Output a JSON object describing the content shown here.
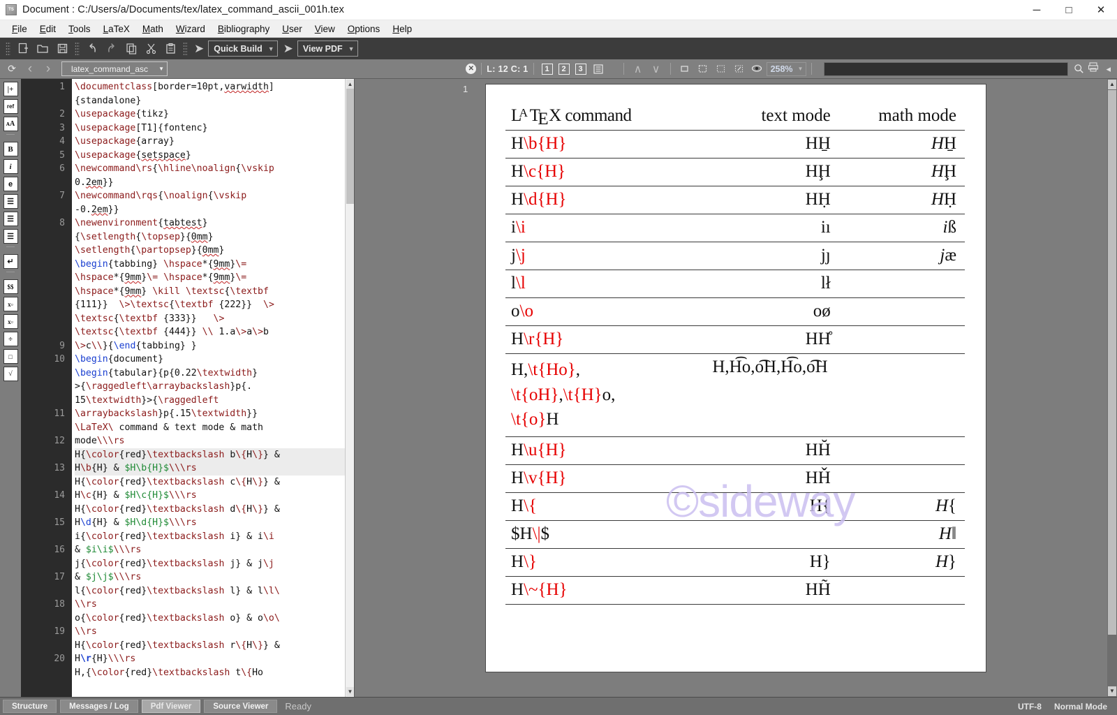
{
  "window": {
    "title": "Document : C:/Users/a/Documents/tex/latex_command_ascii_001h.tex",
    "app_icon": "texstudio-icon",
    "minimize": "─",
    "maximize": "□",
    "close": "✕"
  },
  "menu": [
    {
      "label": "File",
      "accel": "F"
    },
    {
      "label": "Edit",
      "accel": "E"
    },
    {
      "label": "Tools",
      "accel": "T"
    },
    {
      "label": "LaTeX",
      "accel": "L"
    },
    {
      "label": "Math",
      "accel": "M"
    },
    {
      "label": "Wizard",
      "accel": "W"
    },
    {
      "label": "Bibliography",
      "accel": "B"
    },
    {
      "label": "User",
      "accel": "U"
    },
    {
      "label": "View",
      "accel": "V"
    },
    {
      "label": "Options",
      "accel": "O"
    },
    {
      "label": "Help",
      "accel": "H"
    }
  ],
  "toolbar": {
    "buttons": [
      {
        "name": "new-file-icon",
        "glyph": "➕"
      },
      {
        "name": "open-file-icon",
        "glyph": "🗁"
      },
      {
        "name": "save-file-icon",
        "glyph": "💾"
      },
      {
        "name": "undo-icon",
        "glyph": "↶"
      },
      {
        "name": "redo-icon",
        "glyph": "↷"
      },
      {
        "name": "copy-icon",
        "glyph": "⧉"
      },
      {
        "name": "cut-icon",
        "glyph": "✂"
      },
      {
        "name": "paste-icon",
        "glyph": "📋"
      }
    ],
    "build_label": "Quick Build",
    "view_label": "View PDF",
    "run_glyph": "➤"
  },
  "toolbar2": {
    "refresh_icon": "⟳",
    "back_icon": "‹",
    "forward_icon": "›",
    "file_tab": "latex_command_asc",
    "close_doc_icon": "✕",
    "cursor_position": "L: 12 C: 1",
    "layout_buttons": [
      "1",
      "2",
      "3"
    ],
    "outline_icon": "☰",
    "up_icon": "∧",
    "down_icon": "∨",
    "fit_width_icon": "⬚",
    "fit_page_icon": "⛶",
    "zoom_out_icon": "⬜",
    "zoom_in_icon": "⤡",
    "magnify_icon": "👁",
    "zoom_level": "258%",
    "search_placeholder": "",
    "search_icon": "🔍",
    "print_icon": "🖨",
    "collapse_icon": "◂"
  },
  "rail_icons": [
    {
      "name": "insert-icon",
      "label": "|+"
    },
    {
      "name": "reference-icon",
      "label": "ref"
    },
    {
      "name": "font-size-icon",
      "label": "ᴀA"
    },
    {
      "name": "bold-icon",
      "label": "B"
    },
    {
      "name": "italic-icon",
      "label": "i"
    },
    {
      "name": "emphasis-icon",
      "label": "e"
    },
    {
      "name": "align-left-icon",
      "label": "☰"
    },
    {
      "name": "align-center-icon",
      "label": "☰"
    },
    {
      "name": "align-right-icon",
      "label": "☰"
    },
    {
      "name": "newline-icon",
      "label": "↵"
    },
    {
      "name": "math-inline-icon",
      "label": "$$"
    },
    {
      "name": "subscript-icon",
      "label": "x▫"
    },
    {
      "name": "superscript-icon",
      "label": "x▫"
    },
    {
      "name": "division-icon",
      "label": "÷"
    },
    {
      "name": "fraction-icon",
      "label": "□"
    },
    {
      "name": "sqrt-icon",
      "label": "√"
    }
  ],
  "editor": {
    "current_line": 12,
    "line_numbers": [
      1,
      2,
      3,
      4,
      5,
      6,
      7,
      8,
      9,
      10,
      11,
      12,
      13,
      14,
      15,
      16,
      17,
      18,
      19,
      20
    ],
    "source": [
      "\\documentclass[border=10pt,varwidth]{standalone}",
      "\\usepackage{tikz}",
      "\\usepackage[T1]{fontenc}",
      "\\usepackage{array}",
      "\\usepackage{setspace}",
      "\\newcommand\\rs{\\hline\\noalign{\\vskip 0.2em}}",
      "\\newcommand\\rqs{\\noalign{\\vskip -0.2em}}",
      "\\newenvironment{tabtest}{\\setlength{\\topsep}{0mm}\\setlength{\\partopsep}{0mm}\\begin{tabbing} \\hspace*{9mm}\\= \\hspace*{9mm}\\= \\hspace*{9mm}\\= \\hspace*{9mm} \\kill \\textsc{\\textbf{111}}  \\>\\textsc{\\textbf {222}}  \\>\\textsc{\\textbf {333}}   \\>\\textsc{\\textbf {444}} \\\\ 1.a\\>a\\>b\\>c\\\\}{\\end{tabbing} }",
      "\\begin{document}",
      "\\begin{tabular}{p{0.22\\textwidth}>{\\raggedleft\\arraybackslash}p{.15\\textwidth}>{\\raggedleft\\arraybackslash}p{.15\\textwidth}}",
      "\\LaTeX\\ command & text mode & math mode\\\\\\rs",
      "H{\\color{red}\\textbackslash b\\{H\\}} & H\\b{H} & $H\\b{H}$\\\\\\rs",
      "H{\\color{red}\\textbackslash c\\{H\\}} & H\\c{H} & $H\\c{H}$\\\\\\rs",
      "H{\\color{red}\\textbackslash d\\{H\\}} & H\\d{H} & $H\\d{H}$\\\\\\rs",
      "i{\\color{red}\\textbackslash i} & i\\i & $i\\i$\\\\\\rs",
      "j{\\color{red}\\textbackslash j} & j\\j & $j\\j$\\\\\\rs",
      "l{\\color{red}\\textbackslash l} & l\\l\\\\\\rs",
      "o{\\color{red}\\textbackslash o} & o\\o\\\\\\rs",
      "H{\\color{red}\\textbackslash r\\{H\\}} & H\\r{H}\\\\\\rs",
      "H,{\\color{red}\\textbackslash t\\{Ho"
    ]
  },
  "pdf": {
    "page_label": "1",
    "watermark": "©sideway",
    "table": {
      "headers": {
        "col1": "LaTeX command",
        "col2": "text mode",
        "col3": "math mode"
      },
      "rows": [
        {
          "cmd_plain": "H",
          "cmd_red": "\\b{H}",
          "text": "HH̲",
          "math": "HH̲",
          "math_italic_first": true
        },
        {
          "cmd_plain": "H",
          "cmd_red": "\\c{H}",
          "text": "HḨ",
          "math": "HḨ",
          "math_italic_first": true
        },
        {
          "cmd_plain": "H",
          "cmd_red": "\\d{H}",
          "text": "HḤ",
          "math": "HḤ",
          "math_italic_first": true
        },
        {
          "cmd_plain": "i",
          "cmd_red": "\\i",
          "text": "iı",
          "math": "iß",
          "math_italic_first": true
        },
        {
          "cmd_plain": "j",
          "cmd_red": "\\j",
          "text": "jȷ",
          "math": "jæ",
          "math_italic_first": true
        },
        {
          "cmd_plain": "l",
          "cmd_red": "\\l",
          "text": "lł",
          "math": "",
          "math_italic_first": false
        },
        {
          "cmd_plain": "o",
          "cmd_red": "\\o",
          "text": "oø",
          "math": "",
          "math_italic_first": false
        },
        {
          "cmd_plain": "H",
          "cmd_red": "\\r{H}",
          "text": "HH̊",
          "math": "",
          "math_italic_first": false
        },
        {
          "cmd_plain": "H,",
          "cmd_red": "\\t{Ho},\\t{oH},\\t{H}",
          "cmd_tail": "o,",
          "cmd_red2": "\\t{o}",
          "cmd_tail2": "H",
          "text": "H,H͡o,o͡H,H͡o,o͡H",
          "math": "",
          "math_italic_first": false,
          "multiline": true
        },
        {
          "cmd_plain": "H",
          "cmd_red": "\\u{H}",
          "text": "HH̆",
          "math": "",
          "math_italic_first": false
        },
        {
          "cmd_plain": "H",
          "cmd_red": "\\v{H}",
          "text": "HȞ",
          "math": "",
          "math_italic_first": false
        },
        {
          "cmd_plain": "H",
          "cmd_red": "\\{",
          "text": "H{",
          "math": "H{",
          "math_italic_first": true
        },
        {
          "cmd_plain": "$H",
          "cmd_red": "\\|",
          "cmd_tail": "$",
          "text": "",
          "math": "H‖",
          "math_italic_first": true
        },
        {
          "cmd_plain": "H",
          "cmd_red": "\\}",
          "text": "H}",
          "math": "H}",
          "math_italic_first": true
        },
        {
          "cmd_plain": "H",
          "cmd_red": "\\~{H}",
          "text": "HH̃",
          "math": "",
          "math_italic_first": false
        }
      ]
    }
  },
  "statusbar": {
    "tabs": [
      {
        "label": "Structure",
        "active": false
      },
      {
        "label": "Messages / Log",
        "active": false
      },
      {
        "label": "Pdf Viewer",
        "active": true
      },
      {
        "label": "Source Viewer",
        "active": false
      }
    ],
    "status": "Ready",
    "encoding": "UTF-8",
    "mode": "Normal Mode"
  },
  "colors": {
    "toolbar_bg": "#3c3c3c",
    "toolbar2_bg": "#808080",
    "gutter_bg": "#2b2b2b",
    "latex_keyword": "#8b1a1a",
    "begin_end": "#1a3fd0",
    "math_mode": "#1f8a35",
    "pdf_red": "#e60000",
    "watermark": "#cbbff0",
    "page_bg": "#7d7d7d"
  }
}
